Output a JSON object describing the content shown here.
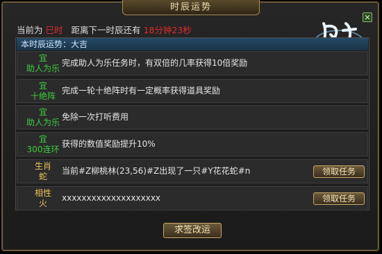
{
  "window": {
    "title": "时辰运势"
  },
  "status": {
    "prefix": "当前为",
    "current_hour": "巳时",
    "countdown_label": "距离下一时辰还有",
    "countdown": "18分钟23秒"
  },
  "panel": {
    "header": "本时辰运势：大吉"
  },
  "rows": [
    {
      "cat1": "宜",
      "cat2": "助人为乐",
      "desc": "完成助人为乐任务时，有双倍的几率获得10倍奖励"
    },
    {
      "cat1": "宜",
      "cat2": "十绝阵",
      "desc": "完成一轮十绝阵时有一定概率获得道具奖励"
    },
    {
      "cat1": "宜",
      "cat2": "助人为乐",
      "desc": "免除一次打听费用"
    },
    {
      "cat1": "宜",
      "cat2": "300连环",
      "desc": "获得的数值奖励提升10%"
    },
    {
      "cat1": "生肖",
      "cat2": "蛇",
      "desc": "当前#Z柳桃林(23,56)#Z出现了一只#Y花花蛇#n",
      "button": "领取任务"
    },
    {
      "cat1": "相性",
      "cat2": "火",
      "desc": "xxxxxxxxxxxxxxxxxxxx",
      "button": "领取任务"
    }
  ],
  "bottom_button": "求签改运",
  "colors": {
    "accent_green": "#3ecb3e",
    "accent_gold": "#e9c35a",
    "alert_red": "#e12b2b"
  }
}
